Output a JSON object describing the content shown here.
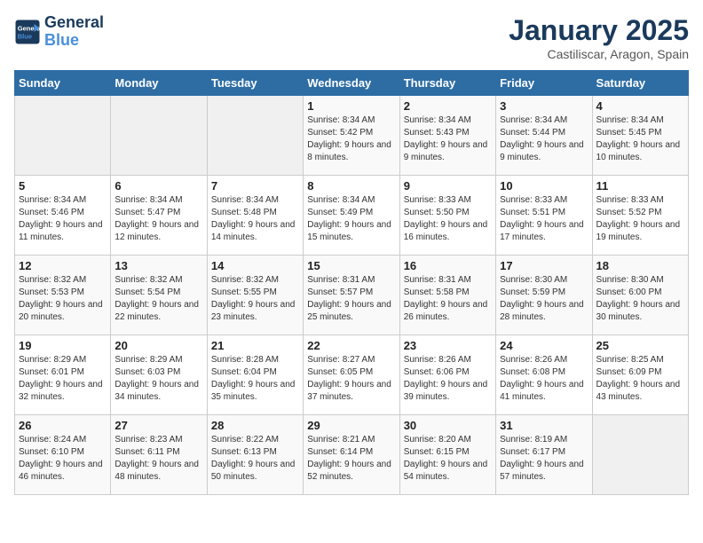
{
  "header": {
    "logo_line1": "General",
    "logo_line2": "Blue",
    "title": "January 2025",
    "subtitle": "Castiliscar, Aragon, Spain"
  },
  "weekdays": [
    "Sunday",
    "Monday",
    "Tuesday",
    "Wednesday",
    "Thursday",
    "Friday",
    "Saturday"
  ],
  "weeks": [
    [
      {
        "day": "",
        "info": ""
      },
      {
        "day": "",
        "info": ""
      },
      {
        "day": "",
        "info": ""
      },
      {
        "day": "1",
        "info": "Sunrise: 8:34 AM\nSunset: 5:42 PM\nDaylight: 9 hours\nand 8 minutes."
      },
      {
        "day": "2",
        "info": "Sunrise: 8:34 AM\nSunset: 5:43 PM\nDaylight: 9 hours\nand 9 minutes."
      },
      {
        "day": "3",
        "info": "Sunrise: 8:34 AM\nSunset: 5:44 PM\nDaylight: 9 hours\nand 9 minutes."
      },
      {
        "day": "4",
        "info": "Sunrise: 8:34 AM\nSunset: 5:45 PM\nDaylight: 9 hours\nand 10 minutes."
      }
    ],
    [
      {
        "day": "5",
        "info": "Sunrise: 8:34 AM\nSunset: 5:46 PM\nDaylight: 9 hours\nand 11 minutes."
      },
      {
        "day": "6",
        "info": "Sunrise: 8:34 AM\nSunset: 5:47 PM\nDaylight: 9 hours\nand 12 minutes."
      },
      {
        "day": "7",
        "info": "Sunrise: 8:34 AM\nSunset: 5:48 PM\nDaylight: 9 hours\nand 14 minutes."
      },
      {
        "day": "8",
        "info": "Sunrise: 8:34 AM\nSunset: 5:49 PM\nDaylight: 9 hours\nand 15 minutes."
      },
      {
        "day": "9",
        "info": "Sunrise: 8:33 AM\nSunset: 5:50 PM\nDaylight: 9 hours\nand 16 minutes."
      },
      {
        "day": "10",
        "info": "Sunrise: 8:33 AM\nSunset: 5:51 PM\nDaylight: 9 hours\nand 17 minutes."
      },
      {
        "day": "11",
        "info": "Sunrise: 8:33 AM\nSunset: 5:52 PM\nDaylight: 9 hours\nand 19 minutes."
      }
    ],
    [
      {
        "day": "12",
        "info": "Sunrise: 8:32 AM\nSunset: 5:53 PM\nDaylight: 9 hours\nand 20 minutes."
      },
      {
        "day": "13",
        "info": "Sunrise: 8:32 AM\nSunset: 5:54 PM\nDaylight: 9 hours\nand 22 minutes."
      },
      {
        "day": "14",
        "info": "Sunrise: 8:32 AM\nSunset: 5:55 PM\nDaylight: 9 hours\nand 23 minutes."
      },
      {
        "day": "15",
        "info": "Sunrise: 8:31 AM\nSunset: 5:57 PM\nDaylight: 9 hours\nand 25 minutes."
      },
      {
        "day": "16",
        "info": "Sunrise: 8:31 AM\nSunset: 5:58 PM\nDaylight: 9 hours\nand 26 minutes."
      },
      {
        "day": "17",
        "info": "Sunrise: 8:30 AM\nSunset: 5:59 PM\nDaylight: 9 hours\nand 28 minutes."
      },
      {
        "day": "18",
        "info": "Sunrise: 8:30 AM\nSunset: 6:00 PM\nDaylight: 9 hours\nand 30 minutes."
      }
    ],
    [
      {
        "day": "19",
        "info": "Sunrise: 8:29 AM\nSunset: 6:01 PM\nDaylight: 9 hours\nand 32 minutes."
      },
      {
        "day": "20",
        "info": "Sunrise: 8:29 AM\nSunset: 6:03 PM\nDaylight: 9 hours\nand 34 minutes."
      },
      {
        "day": "21",
        "info": "Sunrise: 8:28 AM\nSunset: 6:04 PM\nDaylight: 9 hours\nand 35 minutes."
      },
      {
        "day": "22",
        "info": "Sunrise: 8:27 AM\nSunset: 6:05 PM\nDaylight: 9 hours\nand 37 minutes."
      },
      {
        "day": "23",
        "info": "Sunrise: 8:26 AM\nSunset: 6:06 PM\nDaylight: 9 hours\nand 39 minutes."
      },
      {
        "day": "24",
        "info": "Sunrise: 8:26 AM\nSunset: 6:08 PM\nDaylight: 9 hours\nand 41 minutes."
      },
      {
        "day": "25",
        "info": "Sunrise: 8:25 AM\nSunset: 6:09 PM\nDaylight: 9 hours\nand 43 minutes."
      }
    ],
    [
      {
        "day": "26",
        "info": "Sunrise: 8:24 AM\nSunset: 6:10 PM\nDaylight: 9 hours\nand 46 minutes."
      },
      {
        "day": "27",
        "info": "Sunrise: 8:23 AM\nSunset: 6:11 PM\nDaylight: 9 hours\nand 48 minutes."
      },
      {
        "day": "28",
        "info": "Sunrise: 8:22 AM\nSunset: 6:13 PM\nDaylight: 9 hours\nand 50 minutes."
      },
      {
        "day": "29",
        "info": "Sunrise: 8:21 AM\nSunset: 6:14 PM\nDaylight: 9 hours\nand 52 minutes."
      },
      {
        "day": "30",
        "info": "Sunrise: 8:20 AM\nSunset: 6:15 PM\nDaylight: 9 hours\nand 54 minutes."
      },
      {
        "day": "31",
        "info": "Sunrise: 8:19 AM\nSunset: 6:17 PM\nDaylight: 9 hours\nand 57 minutes."
      },
      {
        "day": "",
        "info": ""
      }
    ]
  ]
}
